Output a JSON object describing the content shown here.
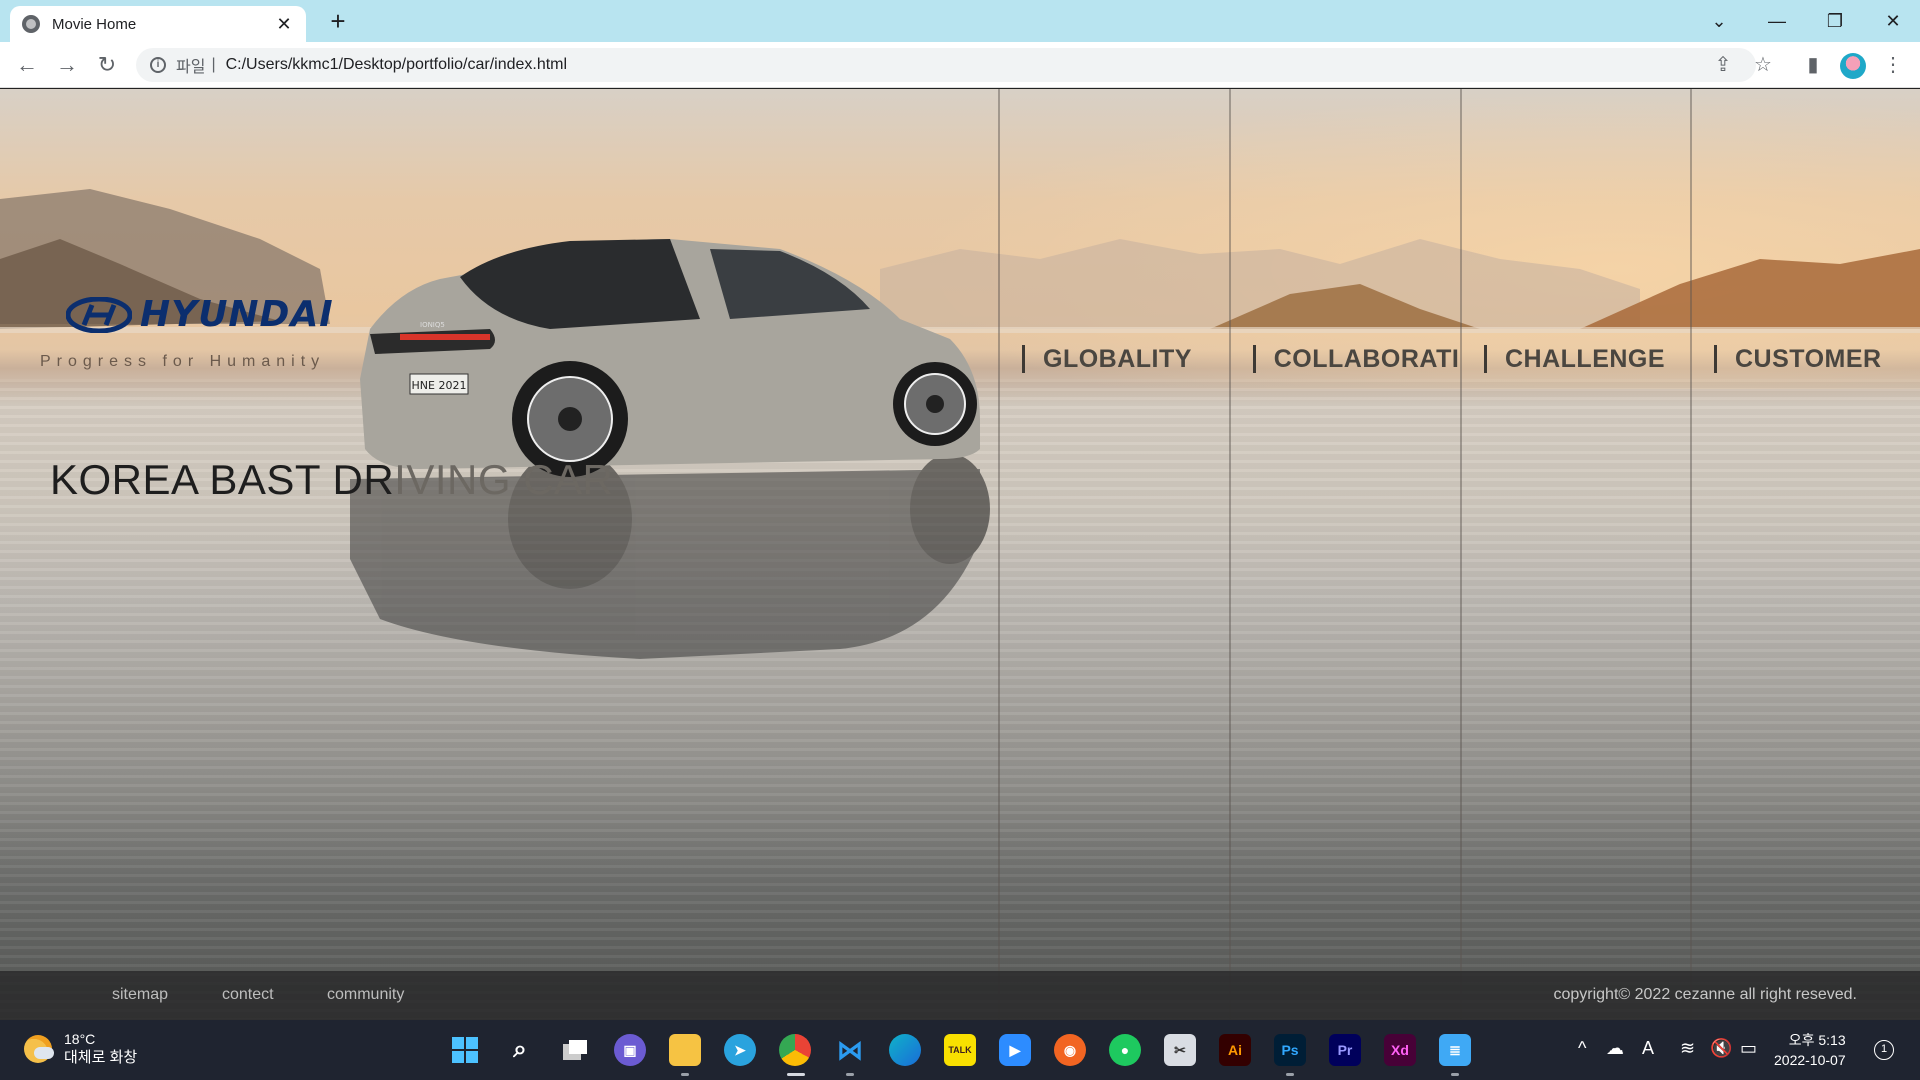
{
  "browser": {
    "tab_title": "Movie Home",
    "tab_close": "✕",
    "new_tab": "+",
    "scheme_label": "파일",
    "url": "C:/Users/kkmc1/Desktop/portfolio/car/index.html",
    "window_controls": [
      "⌄",
      "—",
      "❐",
      "✕"
    ]
  },
  "page": {
    "brand": "HYUNDAI",
    "tagline": "Progress for Humanity",
    "headline_dark": "KOREA BAST DR",
    "headline_light": "IVING CAR",
    "plate": "HNE 2021",
    "car_badge": "IONIQ5",
    "menu": [
      "GLOBALITY",
      "COLLABORATIC",
      "CHALLENGE",
      "CUSTOMER"
    ],
    "footer": {
      "links": [
        "sitemap",
        "contect",
        "community"
      ],
      "copyright": "copyright© 2022 cezanne all right reseved."
    }
  },
  "taskbar": {
    "weather_temp": "18°C",
    "weather_desc": "대체로 화창",
    "apps": [
      "Ai",
      "Ps",
      "Pr",
      "Xd",
      "TALK"
    ],
    "clock_time": "오후 5:13",
    "clock_date": "2022-10-07",
    "notification_count": "1",
    "ime": "A"
  },
  "colors": {
    "brand_blue": "#0b2e6e",
    "tabbar": "#b8e4f0",
    "taskbar": "#1f2430"
  }
}
